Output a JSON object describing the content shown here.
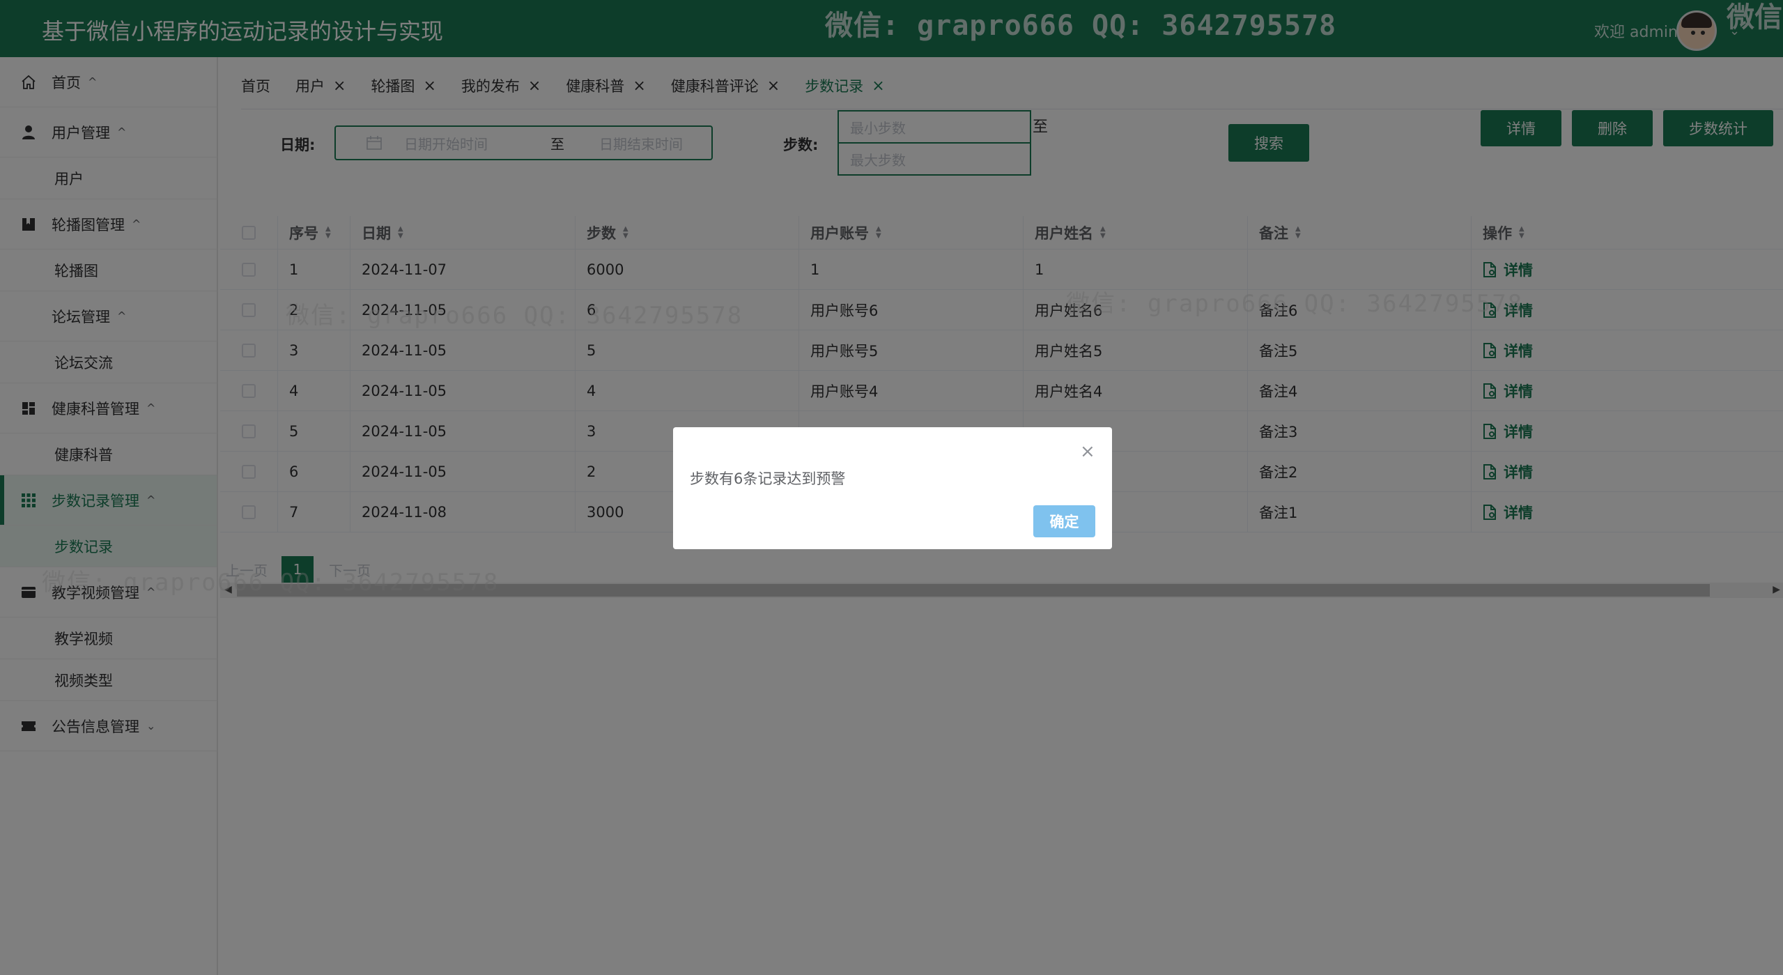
{
  "header": {
    "app_title": "基于微信小程序的运动记录的设计与实现",
    "watermark": "微信: grapro666 QQ: 3642795578",
    "watermark_corner": "微信",
    "welcome": "欢迎 admin",
    "caret": "⌄"
  },
  "sidebar": {
    "items": [
      {
        "label": "首页",
        "icon": "home-icon",
        "caret": "^"
      },
      {
        "label": "用户管理",
        "icon": "user-icon",
        "caret": "^",
        "children": [
          "用户"
        ]
      },
      {
        "label": "轮播图管理",
        "icon": "bookmark-icon",
        "caret": "^",
        "children": [
          "轮播图"
        ]
      },
      {
        "label": "论坛管理",
        "icon": "none",
        "caret": "^",
        "children": [
          "论坛交流"
        ]
      },
      {
        "label": "健康科普管理",
        "icon": "dashboard-icon",
        "caret": "^",
        "children": [
          "健康科普"
        ]
      },
      {
        "label": "步数记录管理",
        "icon": "grid-icon",
        "caret": "^",
        "children": [
          "步数记录"
        ]
      },
      {
        "label": "教学视频管理",
        "icon": "wallet-icon",
        "caret": "^",
        "children": [
          "教学视频",
          "视频类型"
        ]
      },
      {
        "label": "公告信息管理",
        "icon": "ticket-icon",
        "caret": "⌄"
      }
    ]
  },
  "tabs": [
    {
      "label": "首页",
      "close": ""
    },
    {
      "label": "用户",
      "close": "×"
    },
    {
      "label": "轮播图",
      "close": "×"
    },
    {
      "label": "我的发布",
      "close": "×"
    },
    {
      "label": "健康科普",
      "close": "×"
    },
    {
      "label": "健康科普评论",
      "close": "×"
    },
    {
      "label": "步数记录",
      "close": "×"
    }
  ],
  "search": {
    "date_label": "日期:",
    "date_start_placeholder": "日期开始时间",
    "date_sep": "至",
    "date_end_placeholder": "日期结束时间",
    "steps_label": "步数:",
    "min_placeholder": "最小步数",
    "steps_to": "至",
    "max_placeholder": "最大步数",
    "search_button": "搜索"
  },
  "toolbar": {
    "detail_button": "详情",
    "delete_button": "删除",
    "stats_button": "步数统计"
  },
  "table": {
    "columns": [
      "序号",
      "日期",
      "步数",
      "用户账号",
      "用户姓名",
      "备注",
      "操作"
    ],
    "action_label": "详情",
    "rows": [
      {
        "no": "1",
        "date": "2024-11-07",
        "steps": "6000",
        "account": "1",
        "name": "1",
        "note": ""
      },
      {
        "no": "2",
        "date": "2024-11-05",
        "steps": "6",
        "account": "用户账号6",
        "name": "用户姓名6",
        "note": "备注6"
      },
      {
        "no": "3",
        "date": "2024-11-05",
        "steps": "5",
        "account": "用户账号5",
        "name": "用户姓名5",
        "note": "备注5"
      },
      {
        "no": "4",
        "date": "2024-11-05",
        "steps": "4",
        "account": "用户账号4",
        "name": "用户姓名4",
        "note": "备注4"
      },
      {
        "no": "5",
        "date": "2024-11-05",
        "steps": "3",
        "account": "",
        "name": "",
        "note": "备注3"
      },
      {
        "no": "6",
        "date": "2024-11-05",
        "steps": "2",
        "account": "",
        "name": "",
        "note": "备注2"
      },
      {
        "no": "7",
        "date": "2024-11-08",
        "steps": "3000",
        "account": "",
        "name": "",
        "note": "备注1"
      }
    ]
  },
  "pagination": {
    "prev": "上一页",
    "current": "1",
    "next": "下一页"
  },
  "modal": {
    "message": "步数有6条记录达到预警",
    "ok_button": "确定",
    "close": "×"
  },
  "colors": {
    "primary": "#1a7a55",
    "overlay": "rgba(0,0,0,0.5)",
    "ok_button": "#7fc2ee"
  }
}
